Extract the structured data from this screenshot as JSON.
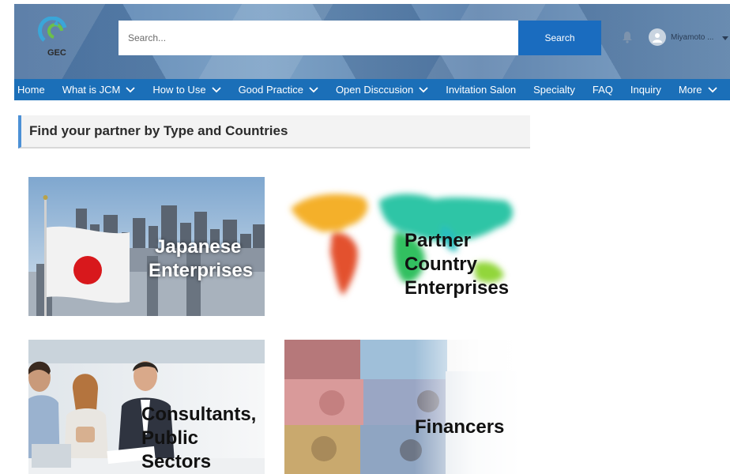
{
  "header": {
    "logo_text": "GEC",
    "search_placeholder": "Search...",
    "search_button": "Search",
    "user_name": "Miyamoto ..."
  },
  "nav": {
    "items": [
      {
        "label": "Home",
        "dropdown": false
      },
      {
        "label": "What is JCM",
        "dropdown": true
      },
      {
        "label": "How to Use",
        "dropdown": true
      },
      {
        "label": "Good Practice",
        "dropdown": true
      },
      {
        "label": "Open Disccusion",
        "dropdown": true
      },
      {
        "label": "Invitation Salon",
        "dropdown": false
      },
      {
        "label": "Specialty",
        "dropdown": false
      },
      {
        "label": "FAQ",
        "dropdown": false
      },
      {
        "label": "Inquiry",
        "dropdown": false
      },
      {
        "label": "More",
        "dropdown": true
      }
    ]
  },
  "section": {
    "title": "Find your partner by Type and Countries"
  },
  "cards": {
    "japanese": {
      "line1": "Japanese",
      "line2": "Enterprises"
    },
    "partner": {
      "line1": "Partner",
      "line2": "Country",
      "line3": "Enterprises"
    },
    "consultants": {
      "line1": "Consultants,",
      "line2": "Public",
      "line3": "Sectors"
    },
    "financers": {
      "line1": "Financers"
    }
  },
  "colors": {
    "nav_blue": "#1b6fb8",
    "search_button": "#1a6cbf",
    "accent_border": "#4c90d6"
  }
}
